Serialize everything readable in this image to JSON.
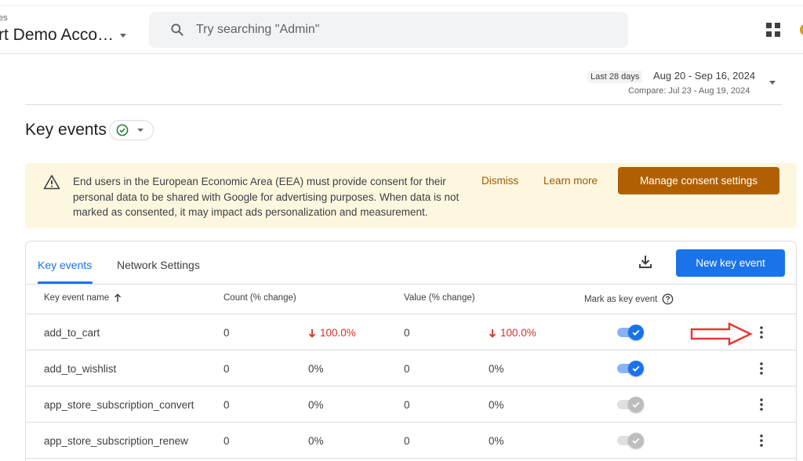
{
  "header": {
    "account_small": "es",
    "account_name": "rt Demo Acco…",
    "search_placeholder": "Try searching \"Admin\""
  },
  "date_range": {
    "badge": "Last 28 days",
    "range": "Aug 20 - Sep 16, 2024",
    "compare": "Compare: Jul 23 - Aug 19, 2024"
  },
  "page": {
    "title": "Key events"
  },
  "banner": {
    "text": "End users in the European Economic Area (EEA) must provide consent for their personal data to be shared with Google for advertising purposes. When data is not marked as consented, it may impact ads personalization and measurement.",
    "dismiss": "Dismiss",
    "learn_more": "Learn more",
    "manage": "Manage consent settings"
  },
  "tabs": [
    "Key events",
    "Network Settings"
  ],
  "actions": {
    "new_key_event": "New key event"
  },
  "table": {
    "columns": [
      "Key event name",
      "Count (% change)",
      "Value (% change)",
      "Mark as key event"
    ],
    "rows": [
      {
        "name": "add_to_cart",
        "count": "0",
        "count_change": "100.0%",
        "value": "0",
        "value_change": "100.0%",
        "marked": true,
        "negative": true
      },
      {
        "name": "add_to_wishlist",
        "count": "0",
        "count_change": "0%",
        "value": "0",
        "value_change": "0%",
        "marked": true,
        "negative": false
      },
      {
        "name": "app_store_subscription_convert",
        "count": "0",
        "count_change": "0%",
        "value": "0",
        "value_change": "0%",
        "marked": false,
        "negative": false
      },
      {
        "name": "app_store_subscription_renew",
        "count": "0",
        "count_change": "0%",
        "value": "0",
        "value_change": "0%",
        "marked": false,
        "negative": false
      }
    ]
  },
  "colors": {
    "accent": "#1a73e8",
    "banner_bg": "#fef7e0",
    "banner_button": "#b06000",
    "negative": "#d93025",
    "annotation": "#e53935"
  }
}
